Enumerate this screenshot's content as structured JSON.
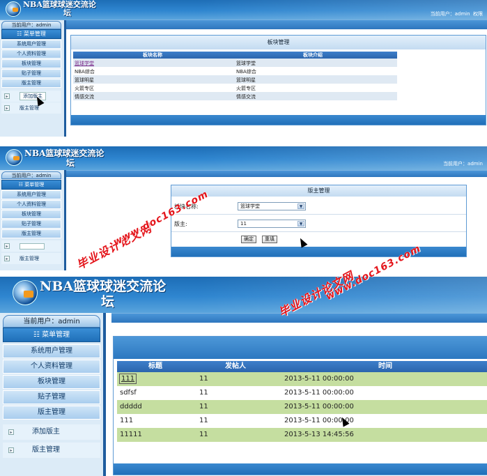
{
  "app": {
    "title": "NBA篮球球迷交流论坛",
    "title_line1": "NBA篮球球迷交流论",
    "title_line2": "坛"
  },
  "header": {
    "current_user": "当前用户：admin",
    "current_user_label": "当前用户：",
    "user": "admin",
    "extra": "权限"
  },
  "menu": {
    "user_box": "当前用户：admin",
    "title": "菜单管理",
    "items": [
      "系统用户管理",
      "个人资料管理",
      "板块管理",
      "贴子管理",
      "版主管理"
    ],
    "sub_items": [
      "添加版主",
      "版主管理"
    ]
  },
  "screen1": {
    "panel_title": "板块管理",
    "columns": [
      "板块名称",
      "板块介绍"
    ],
    "rows": [
      [
        "篮球学堂",
        "篮球学堂"
      ],
      [
        "NBA综合",
        "NBA综合"
      ],
      [
        "篮球明星",
        "篮球明星"
      ],
      [
        "火箭专区",
        "火箭专区"
      ],
      [
        "情感交流",
        "情感交流"
      ]
    ]
  },
  "screen2": {
    "panel_title": "版主管理",
    "field1_label": "板块名称:",
    "field1_value": "篮球学堂",
    "field2_label": "版主:",
    "field2_value": "11",
    "confirm_button": "确定",
    "reset_button": "重填"
  },
  "screen3": {
    "columns": [
      "标题",
      "发帖人",
      "时间"
    ],
    "rows": [
      [
        "111",
        "11",
        "2013-5-11 00:00:00"
      ],
      [
        "sdfsf",
        "11",
        "2013-5-11 00:00:00"
      ],
      [
        "ddddd",
        "11",
        "2013-5-11 00:00:00"
      ],
      [
        "111",
        "11",
        "2013-5-11 00:00:00"
      ],
      [
        "11111",
        "11",
        "2013-5-13 14:45:56"
      ]
    ]
  },
  "watermark": {
    "line1": "毕业设计论文网",
    "line2": "www.doc163.com"
  },
  "colors": {
    "header_blue": "#2f86d0",
    "nav_dark": "#164f8c",
    "row_green": "#c5dea0",
    "watermark_red": "#e4151b"
  }
}
